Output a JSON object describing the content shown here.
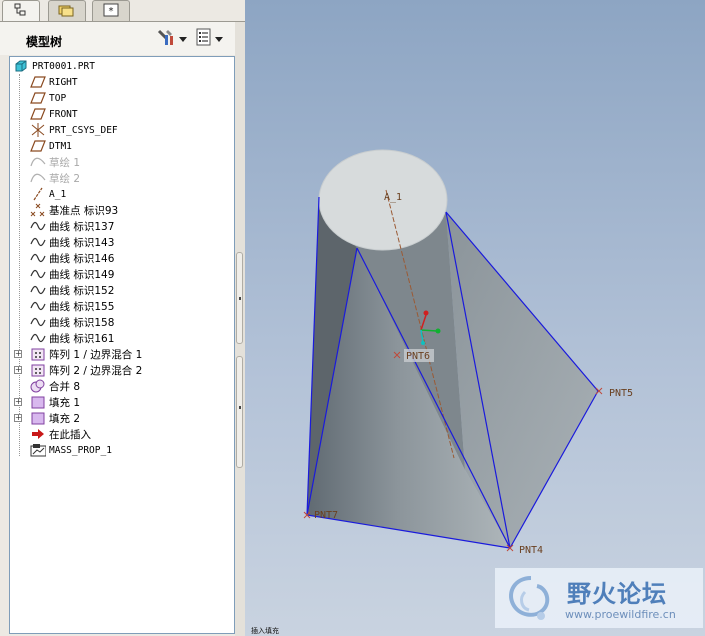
{
  "tabs": [
    {
      "name": "model-tree-tab",
      "active": true
    },
    {
      "name": "folder-browser-tab",
      "active": false
    },
    {
      "name": "favorites-tab",
      "active": false
    }
  ],
  "tree_panel": {
    "title": "模型树"
  },
  "tree": [
    {
      "label": "PRT0001.PRT",
      "icon": "part-icon",
      "indent": 0,
      "dim": false,
      "expander": false
    },
    {
      "label": "RIGHT",
      "icon": "datum-plane-icon",
      "indent": 1,
      "dim": false,
      "expander": false
    },
    {
      "label": "TOP",
      "icon": "datum-plane-icon",
      "indent": 1,
      "dim": false,
      "expander": false
    },
    {
      "label": "FRONT",
      "icon": "datum-plane-icon",
      "indent": 1,
      "dim": false,
      "expander": false
    },
    {
      "label": "PRT_CSYS_DEF",
      "icon": "csys-icon",
      "indent": 1,
      "dim": false,
      "expander": false
    },
    {
      "label": "DTM1",
      "icon": "datum-plane-icon",
      "indent": 1,
      "dim": false,
      "expander": false
    },
    {
      "label": "草绘 1",
      "icon": "sketch-icon",
      "indent": 1,
      "dim": true,
      "expander": false
    },
    {
      "label": "草绘 2",
      "icon": "sketch-icon",
      "indent": 1,
      "dim": true,
      "expander": false
    },
    {
      "label": "A_1",
      "icon": "axis-icon",
      "indent": 1,
      "dim": false,
      "expander": false
    },
    {
      "label": "基准点 标识93",
      "icon": "datum-point-icon",
      "indent": 1,
      "dim": false,
      "expander": false
    },
    {
      "label": "曲线 标识137",
      "icon": "curve-icon",
      "indent": 1,
      "dim": false,
      "expander": false
    },
    {
      "label": "曲线 标识143",
      "icon": "curve-icon",
      "indent": 1,
      "dim": false,
      "expander": false
    },
    {
      "label": "曲线 标识146",
      "icon": "curve-icon",
      "indent": 1,
      "dim": false,
      "expander": false
    },
    {
      "label": "曲线 标识149",
      "icon": "curve-icon",
      "indent": 1,
      "dim": false,
      "expander": false
    },
    {
      "label": "曲线 标识152",
      "icon": "curve-icon",
      "indent": 1,
      "dim": false,
      "expander": false
    },
    {
      "label": "曲线 标识155",
      "icon": "curve-icon",
      "indent": 1,
      "dim": false,
      "expander": false
    },
    {
      "label": "曲线 标识158",
      "icon": "curve-icon",
      "indent": 1,
      "dim": false,
      "expander": false
    },
    {
      "label": "曲线 标识161",
      "icon": "curve-icon",
      "indent": 1,
      "dim": false,
      "expander": false
    },
    {
      "label": "阵列 1 / 边界混合 1",
      "icon": "pattern-icon",
      "indent": 1,
      "dim": false,
      "expander": true
    },
    {
      "label": "阵列 2 / 边界混合 2",
      "icon": "pattern-icon",
      "indent": 1,
      "dim": false,
      "expander": true
    },
    {
      "label": "合并 8",
      "icon": "merge-icon",
      "indent": 1,
      "dim": false,
      "expander": false
    },
    {
      "label": "填充 1",
      "icon": "fill-icon",
      "indent": 1,
      "dim": false,
      "expander": true
    },
    {
      "label": "填充 2",
      "icon": "fill-icon",
      "indent": 1,
      "dim": false,
      "expander": true
    },
    {
      "label": "在此插入",
      "icon": "insert-here-icon",
      "indent": 1,
      "dim": false,
      "expander": false
    },
    {
      "label": "MASS_PROP_1",
      "icon": "analysis-icon",
      "indent": 1,
      "dim": false,
      "expander": false
    }
  ],
  "viewport": {
    "labels": {
      "axis": "A_1",
      "pnt6": "PNT6",
      "pnt5": "PNT5",
      "pnt7": "PNT7",
      "pnt4": "PNT4"
    },
    "status_text": "插入填充"
  },
  "watermark": {
    "cn": "野火论坛",
    "url": "www.proewildfire.cn"
  },
  "colors": {
    "viewport_bg": "#a4b7cf",
    "edge_blue": "#1a1adc",
    "axis_brown": "#9b5a34"
  }
}
